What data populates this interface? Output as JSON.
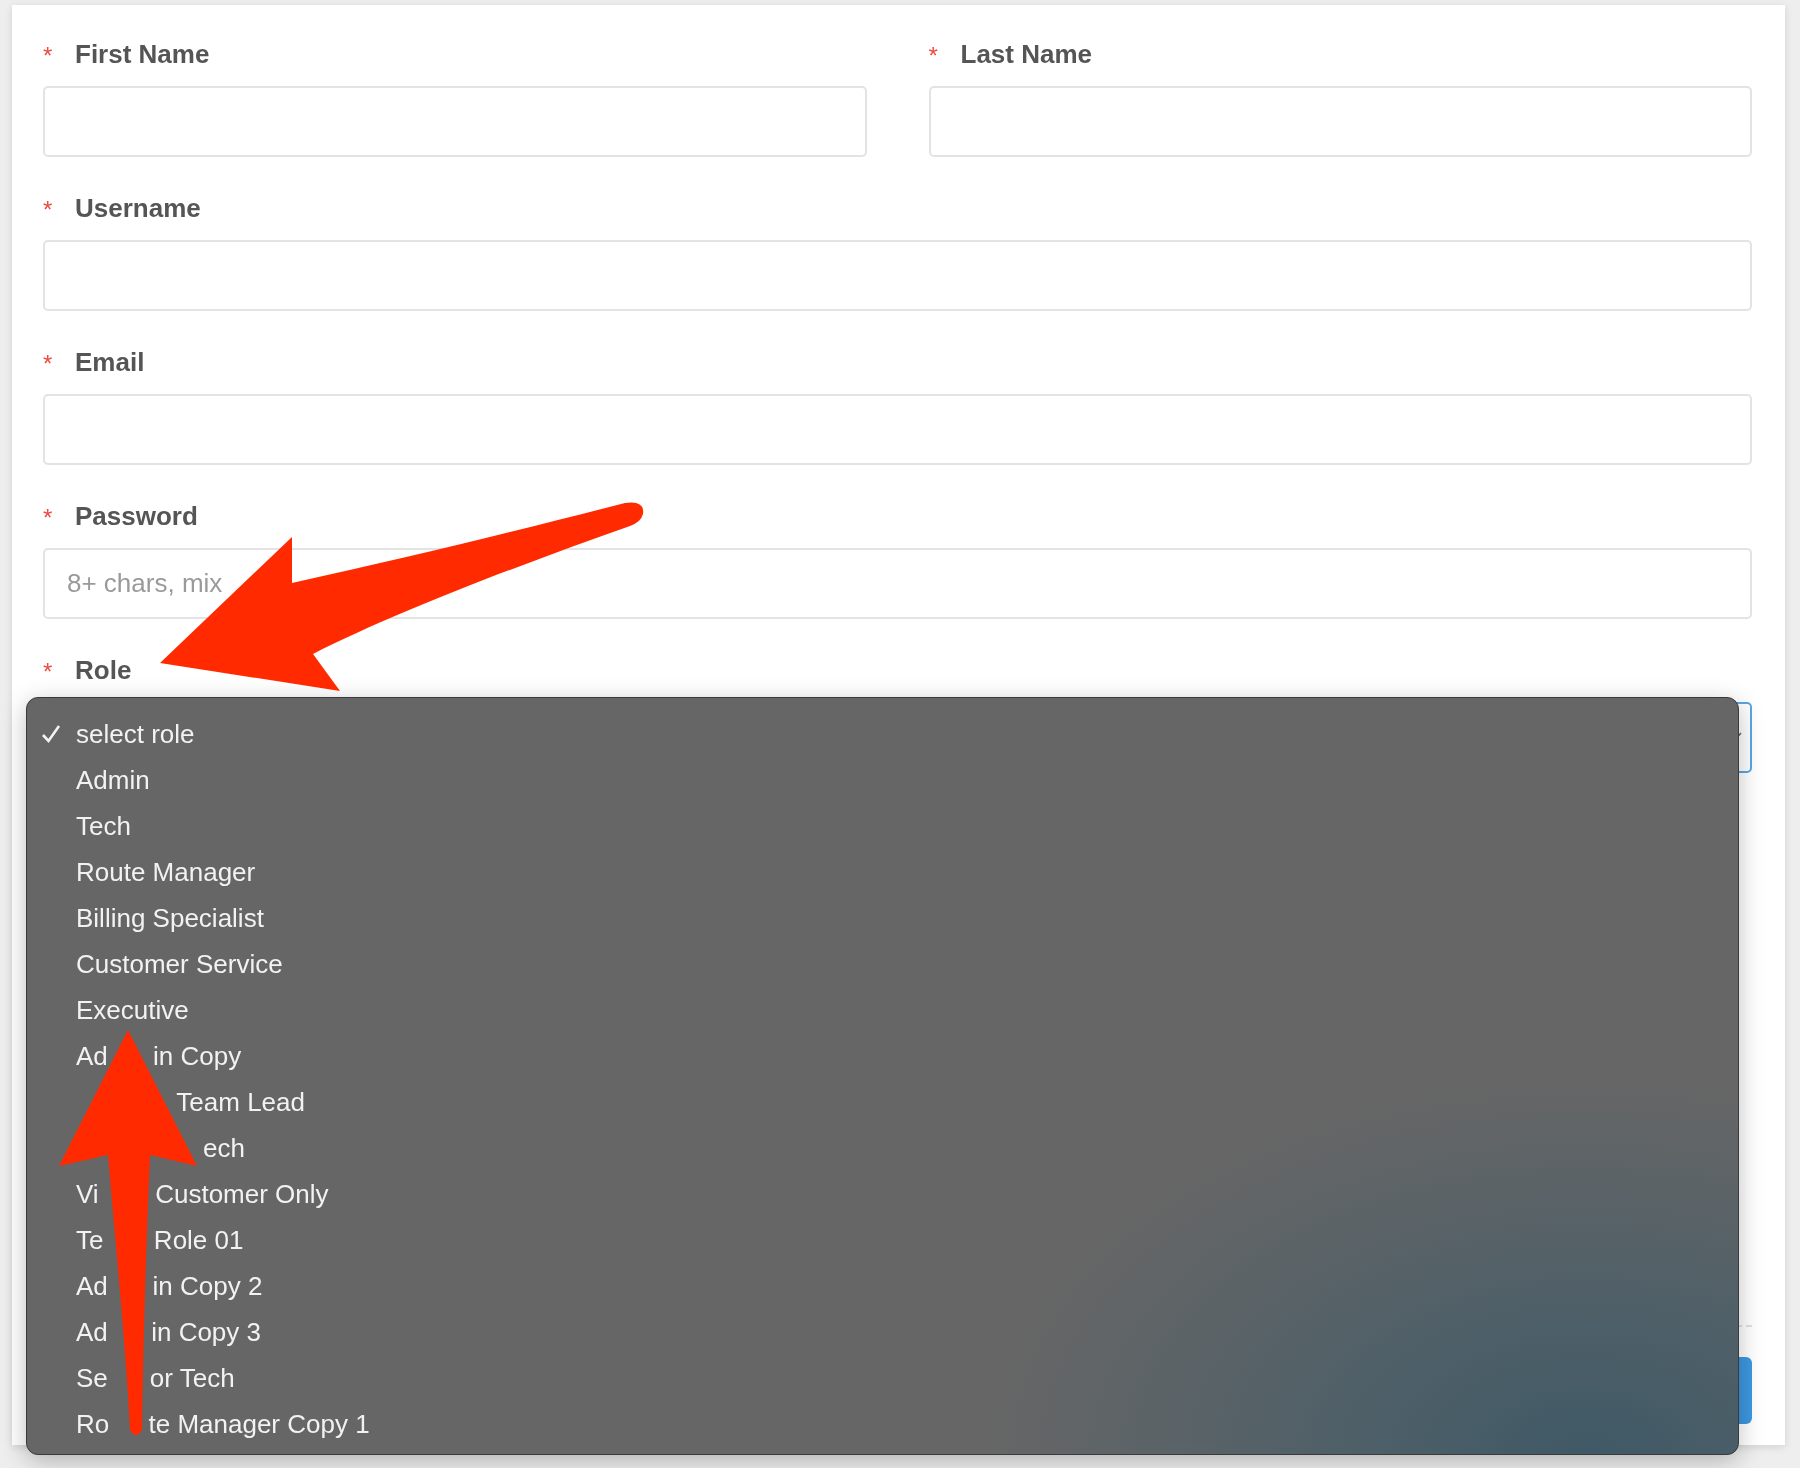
{
  "form": {
    "rows": [
      [
        {
          "kind": "text",
          "required_mark": "*",
          "label": "First Name"
        },
        {
          "kind": "text",
          "required_mark": "*",
          "label": "Last Name"
        }
      ],
      [
        {
          "kind": "text",
          "required_mark": "*",
          "label": "Username"
        }
      ],
      [
        {
          "kind": "text",
          "required_mark": "*",
          "label": "Email"
        }
      ],
      [
        {
          "kind": "text",
          "required_mark": "*",
          "label": "Password",
          "placeholder": "8+ chars, mix"
        }
      ],
      [
        {
          "kind": "select",
          "required_mark": "*",
          "label": "Role",
          "focused": true,
          "open": true
        }
      ]
    ]
  },
  "role_menu": {
    "options": [
      {
        "parts": [
          "select role"
        ],
        "selected": true
      },
      {
        "parts": [
          "Admin"
        ],
        "selected": false
      },
      {
        "parts": [
          "Tech"
        ],
        "selected": false
      },
      {
        "parts": [
          "Route Manager"
        ],
        "selected": false
      },
      {
        "parts": [
          "Billing Specialist"
        ],
        "selected": false
      },
      {
        "parts": [
          "Customer Service"
        ],
        "selected": false
      },
      {
        "parts": [
          "Executive"
        ],
        "selected": false
      },
      {
        "parts": [
          "Ad",
          "in Copy"
        ],
        "selected": false
      },
      {
        "parts": [
          "Team Lead"
        ],
        "selected": false
      },
      {
        "parts": [
          "ech"
        ],
        "selected": false
      },
      {
        "parts": [
          "Vi",
          "Customer Only"
        ],
        "selected": false
      },
      {
        "parts": [
          "Te",
          "Role 01"
        ],
        "selected": false
      },
      {
        "parts": [
          "Ad",
          "in Copy 2"
        ],
        "selected": false
      },
      {
        "parts": [
          "Ad",
          "in Copy 3"
        ],
        "selected": false
      },
      {
        "parts": [
          "Se",
          "or Tech"
        ],
        "selected": false
      },
      {
        "parts": [
          "Ro",
          "te Manager Copy 1"
        ],
        "selected": false
      }
    ]
  }
}
